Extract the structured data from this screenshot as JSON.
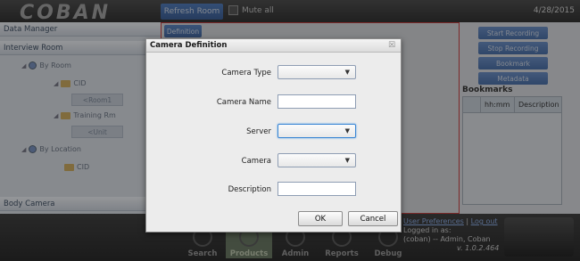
{
  "topbar": {
    "logo_text": "COBAN",
    "refresh_button": "Refresh Room",
    "mute_label": "Mute all",
    "date": "4/28/2015"
  },
  "left_panel": {
    "data_manager": "Data Manager",
    "interview_room": "Interview Room",
    "tree": {
      "by_room": "By Room",
      "cid": "CID",
      "room1": "<Room1",
      "training_rm": "Training Rm",
      "unit": "<Unit",
      "by_location": "By Location",
      "cid2": "CID"
    },
    "body_camera": "Body Camera"
  },
  "center": {
    "definition_button": "Definition"
  },
  "right_panel": {
    "start_recording": "Start Recording",
    "stop_recording": "Stop Recording",
    "bookmark": "Bookmark",
    "metadata": "Metadata",
    "bookmarks_title": "Bookmarks",
    "columns": [
      "hh:mm",
      "Description"
    ]
  },
  "bottom_nav": {
    "items": [
      {
        "label": "Search",
        "icon": "search-icon"
      },
      {
        "label": "Products",
        "icon": "products-icon"
      },
      {
        "label": "Admin",
        "icon": "admin-icon"
      },
      {
        "label": "Reports",
        "icon": "reports-icon"
      },
      {
        "label": "Debug",
        "icon": "debug-icon"
      }
    ],
    "active": "Products",
    "user_preferences": "User Preferences",
    "separator": "|",
    "log_out": "Log out",
    "logged_in_as": "Logged in as:",
    "user": "(coban) -- Admin, Coban",
    "version": "v. 1.0.2.464"
  },
  "dialog": {
    "title": "Camera Definition",
    "close_glyph": "☒",
    "fields": {
      "camera_type": {
        "label": "Camera Type",
        "value": ""
      },
      "camera_name": {
        "label": "Camera Name",
        "value": ""
      },
      "server": {
        "label": "Server",
        "value": ""
      },
      "camera": {
        "label": "Camera",
        "value": ""
      },
      "description": {
        "label": "Description",
        "value": ""
      }
    },
    "ok_label": "OK",
    "cancel_label": "Cancel"
  },
  "colors": {
    "accent_blue": "#3a86d4",
    "frame_red": "#c02a2a",
    "link": "#7fa3e0"
  }
}
